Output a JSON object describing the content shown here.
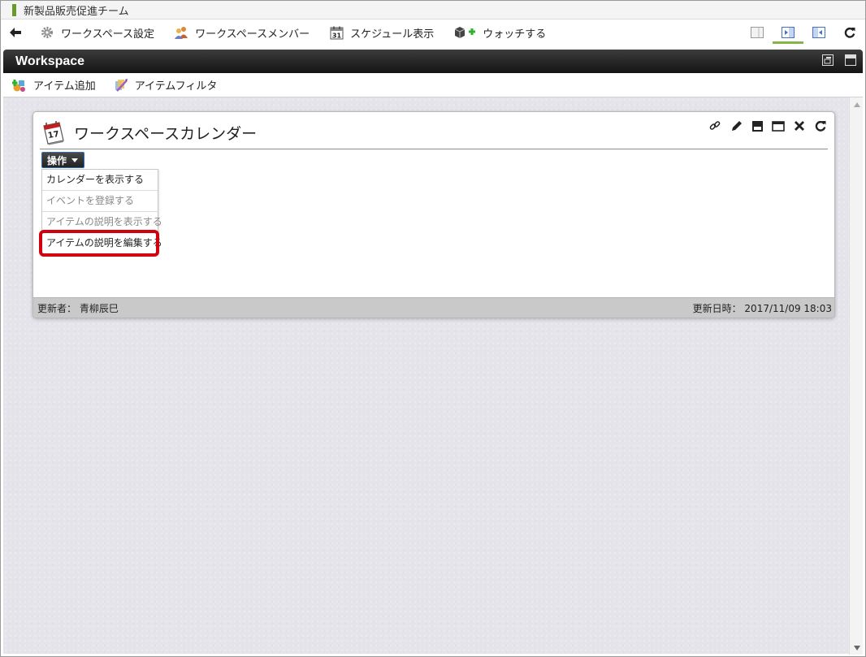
{
  "window": {
    "title": "新製品販売促進チーム"
  },
  "toolbar": {
    "items": [
      {
        "label": "ワークスペース設定",
        "icon": "gear-icon"
      },
      {
        "label": "ワークスペースメンバー",
        "icon": "members-icon"
      },
      {
        "label": "スケジュール表示",
        "icon": "calendar-icon",
        "calendar_day": "31"
      },
      {
        "label": "ウォッチする",
        "icon": "watch-add-icon"
      }
    ],
    "right_buttons": [
      "layout-single-icon",
      "layout-right-pane-icon",
      "layout-left-pane-icon",
      "refresh-icon"
    ],
    "active_button": "layout-right-pane-icon"
  },
  "workspace": {
    "title": "Workspace",
    "sub_items": [
      {
        "label": "アイテム追加",
        "icon": "add-item-icon"
      },
      {
        "label": "アイテムフィルタ",
        "icon": "filter-icon"
      }
    ]
  },
  "portlet": {
    "title": "ワークスペースカレンダー",
    "calendar_day": "17",
    "operations_label": "操作",
    "menu_items": [
      {
        "label": "カレンダーを表示する",
        "enabled": true
      },
      {
        "label": "イベントを登録する",
        "enabled": false
      },
      {
        "label": "アイテムの説明を表示する",
        "enabled": false
      },
      {
        "label": "アイテムの説明を編集する",
        "enabled": true,
        "highlighted": true
      }
    ],
    "footer": {
      "updated_by": "更新者： 青柳辰巳",
      "updated_at": "更新日時： 2017/11/09 18:03"
    }
  },
  "colors": {
    "accent_green": "#86b64a",
    "highlight_red": "#d0000f",
    "workspace_bar": "#222222"
  }
}
